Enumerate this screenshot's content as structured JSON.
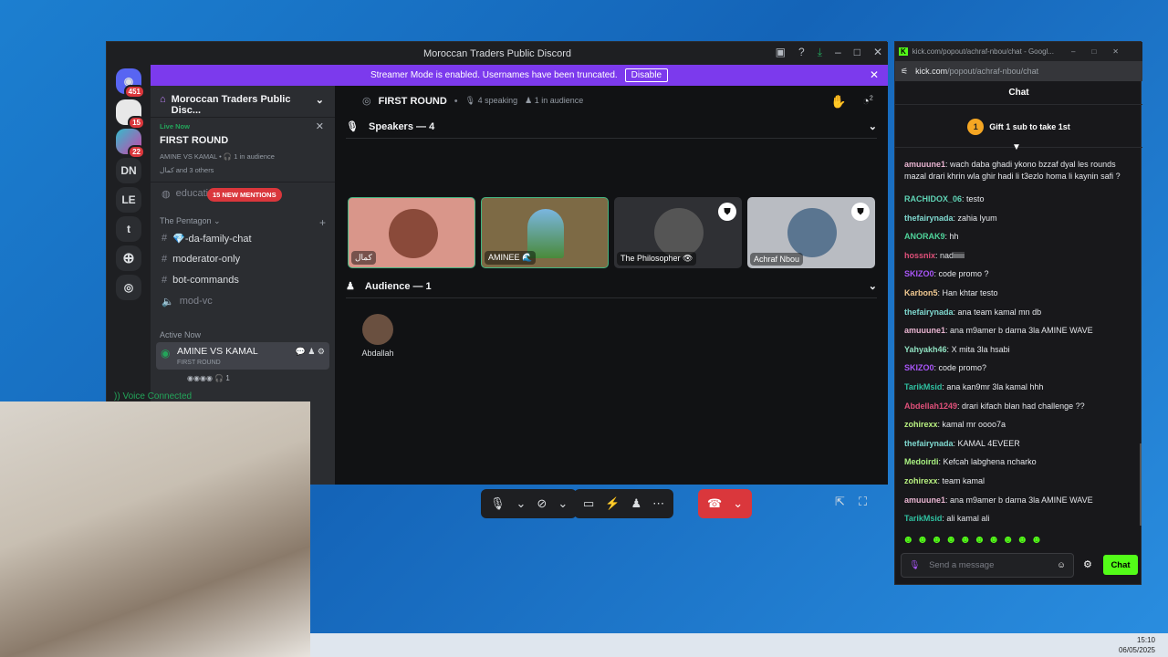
{
  "discord": {
    "window_title": "Moroccan Traders Public Discord",
    "banner": {
      "text": "Streamer Mode is enabled. Usernames have been truncated.",
      "button": "Disable"
    },
    "rail": {
      "home_badge": "451",
      "server1_badge": "15",
      "server2_badge": "22",
      "servers": [
        "DN",
        "LE",
        "t"
      ]
    },
    "server_name": "Moroccan Traders Public Disc...",
    "live": {
      "label": "Live Now",
      "title": "FIRST ROUND",
      "sub": "AMINE VS KAMAL • 🎧 1 in audience",
      "people": "كمال and 3 others"
    },
    "mentions_channel": "educati",
    "mentions_pill": "15 NEW MENTIONS",
    "category": "The Pentagon",
    "channels": [
      "💎-da-family-chat",
      "moderator-only",
      "bot-commands",
      "mod-vc"
    ],
    "active_now_label": "Active Now",
    "active_stage": {
      "name": "AMINE VS KAMAL",
      "sub": "FIRST ROUND",
      "count": "1"
    },
    "voice_connected": "Voice Connected",
    "stage": {
      "title": "FIRST ROUND",
      "speaking": "4 speaking",
      "audience": "1 in audience",
      "hands_count": "2"
    },
    "speakers_header": "Speakers — 4",
    "speakers": [
      {
        "name": "كمال",
        "bg": "#d9968a"
      },
      {
        "name": "AMINEE 🌊",
        "bg": "#7d6a45"
      },
      {
        "name": "The Philosopher 👁",
        "bg": "#2f3034"
      },
      {
        "name": "Achraf Nbou",
        "bg": "#b9bcc2"
      }
    ],
    "audience_header": "Audience — 1",
    "audience": [
      {
        "name": "Abdallah"
      }
    ]
  },
  "kick": {
    "window_title": "kick.com/popout/achraf-nbou/chat - Googl...",
    "url_host": "kick.com",
    "url_path": "/popout/achraf-nbou/chat",
    "header": "Chat",
    "gift": "Gift 1 sub to take 1st",
    "messages": [
      {
        "user": "amuuune1",
        "text": "wach daba ghadi ykono bzzaf dyal les rounds mazal drari khrin wla ghir hadi li t3ezlo homa li kaynin safi ?",
        "color": "#e8b4d0"
      },
      {
        "user": "RACHIDOX_06",
        "text": "testo",
        "color": "#5fd3b5"
      },
      {
        "user": "thefairynada",
        "text": "zahia lyum",
        "color": "#7fd8cf"
      },
      {
        "user": "ANORAK9",
        "text": "hh",
        "color": "#4fd39a"
      },
      {
        "user": "hossnix",
        "text": "nadiiiiii",
        "color": "#e0507a"
      },
      {
        "user": "SKIZO0",
        "text": "code promo ?",
        "color": "#a855f7"
      },
      {
        "user": "Karbon5",
        "text": "Han khtar testo",
        "color": "#f0c890"
      },
      {
        "user": "thefairynada",
        "text": "ana team kamal mn db",
        "color": "#7fd8cf"
      },
      {
        "user": "amuuune1",
        "text": "ana m9amer b darna 3la AMINE WAVE",
        "color": "#e8b4d0"
      },
      {
        "user": "Yahyakh46",
        "text": "X mita 3la hsabi",
        "color": "#8fe0c0"
      },
      {
        "user": "SKIZO0",
        "text": "code promo?",
        "color": "#a855f7"
      },
      {
        "user": "TarikMsid",
        "text": "ana kan9mr 3la kamal hhh",
        "color": "#2fc0a0"
      },
      {
        "user": "Abdellah1249",
        "text": "drari kifach blan had challenge ??",
        "color": "#e0507a"
      },
      {
        "user": "zohirexx",
        "text": "kamal mr oooo7a",
        "color": "#b8f080"
      },
      {
        "user": "thefairynada",
        "text": "KAMAL 4EVEER",
        "color": "#7fd8cf"
      },
      {
        "user": "Medoirdi",
        "text": "Kefcah labghena ncharko",
        "color": "#a8f080"
      },
      {
        "user": "zohirexx",
        "text": "team kamal",
        "color": "#b8f080"
      },
      {
        "user": "amuuune1",
        "text": "ana m9amer b darna 3la AMINE WAVE",
        "color": "#e8b4d0"
      },
      {
        "user": "TarikMsid",
        "text": "ali kamal ali",
        "color": "#2fc0a0"
      }
    ],
    "input_placeholder": "Send a message",
    "send_button": "Chat",
    "accent": "#53fc18"
  },
  "taskbar": {
    "time": "15:10",
    "date": "06/05/2025"
  }
}
